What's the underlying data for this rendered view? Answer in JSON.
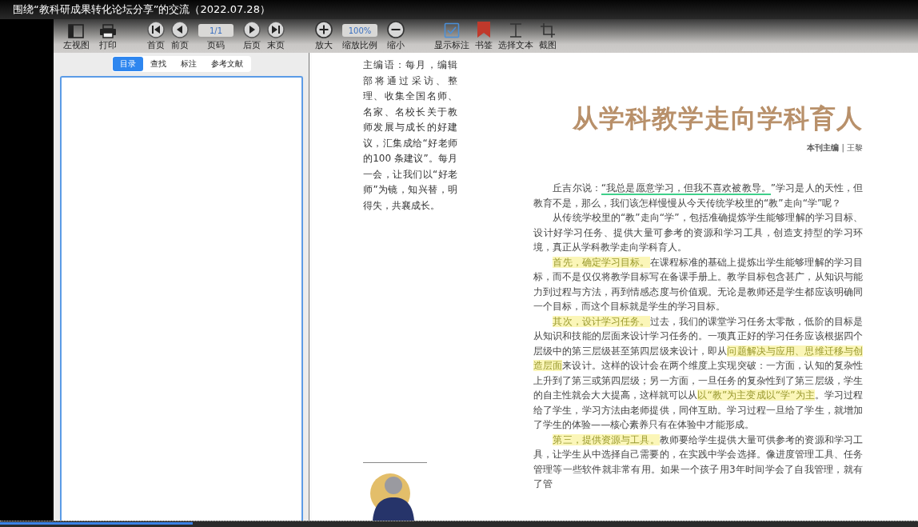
{
  "video_title": "围绕“教科研成果转化论坛分享”的交流（2022.07.28）",
  "toolbar": {
    "groups": [
      [
        {
          "kind": "button",
          "label": "左视图"
        },
        {
          "kind": "button",
          "label": "打印"
        }
      ],
      [
        {
          "kind": "button",
          "label": "首页"
        },
        {
          "kind": "button",
          "label": "前页"
        },
        {
          "kind": "field",
          "label": "页码",
          "value": "1/1"
        },
        {
          "kind": "button",
          "label": "后页"
        },
        {
          "kind": "button",
          "label": "末页"
        }
      ],
      [
        {
          "kind": "button",
          "label": "放大"
        },
        {
          "kind": "field",
          "label": "缩放比例",
          "value": "100%"
        },
        {
          "kind": "button",
          "label": "缩小"
        }
      ],
      [
        {
          "kind": "toggle",
          "label": "显示标注",
          "checked": true
        },
        {
          "kind": "button",
          "label": "书签"
        },
        {
          "kind": "button",
          "label": "选择文本"
        },
        {
          "kind": "button",
          "label": "截图"
        }
      ]
    ]
  },
  "sidebar": {
    "tabs": [
      {
        "label": "目录",
        "selected": true
      },
      {
        "label": "查找",
        "selected": false
      },
      {
        "label": "标注",
        "selected": false
      },
      {
        "label": "参考文献",
        "selected": false
      }
    ]
  },
  "page": {
    "intro": "主编语：每月，编辑部将通过采访、整理、收集全国名师、名家、名校长关于教师发展与成长的好建议，汇集成给“好老师的100 条建议”。每月一会，让我们以“好老师”为镜，知兴替，明得失，共襄成长。",
    "title": "从学科教学走向学科育人",
    "byline": "**本刊主编** | 王黎",
    "paragraphs": [
      {
        "segments": [
          {
            "kind": "plain",
            "text": "丘吉尔说："
          },
          {
            "kind": "underline",
            "text": "“我总是愿意学习，但我不喜欢被教导。"
          },
          {
            "kind": "plain",
            "text": "”学习是人的天性，但教育不是，那么，我们该怎样慢慢从今天传统学校里的“教”走向“学”呢？"
          }
        ]
      },
      {
        "segments": [
          {
            "kind": "plain",
            "text": "从传统学校里的“教”走向“学”，包括准确提炼学生能够理解的学习目标、设计好学习任务、提供大量可参考的资源和学习工具，创造支持型的学习环境，真正从学科教学走向学科育人。"
          }
        ]
      },
      {
        "segments": [
          {
            "kind": "highlight",
            "text": "首先，确定学习目标。"
          },
          {
            "kind": "plain",
            "text": "在课程标准的基础上提炼出学生能够理解的学习目标，而不是仅仅将教学目标写在备课手册上。教学目标包含甚广，从知识与能力到过程与方法，再到情感态度与价值观。无论是教师还是学生都应该明确同一个目标，而这个目标就是学生的学习目标。"
          }
        ]
      },
      {
        "segments": [
          {
            "kind": "highlight",
            "text": "其次，设计学习任务。"
          },
          {
            "kind": "plain",
            "text": "过去，我们的课堂学习任务太零散，低阶的目标是从知识和技能的层面来设计学习任务的。一项真正好的学习任务应该根据四个层级中的第三层级甚至第四层级来设计，即从"
          },
          {
            "kind": "highlight",
            "text": "问题解决与应用、思维迁移与创造层面"
          },
          {
            "kind": "plain",
            "text": "来设计。这样的设计会在两个维度上实现突破：一方面，认知的复杂性上升到了第三或第四层级；另一方面，一旦任务的复杂性到了第三层级，学生的自主性就会大大提高，这样就可以从"
          },
          {
            "kind": "highlight",
            "text": "以“教”为主变成以“学”为主"
          },
          {
            "kind": "plain",
            "text": "。学习过程给了学生，学习方法由老师提供，同伴互助。学习过程一旦给了学生，就增加了学生的体验——核心素养只有在体验中才能形成。"
          }
        ]
      },
      {
        "segments": [
          {
            "kind": "highlight",
            "text": "第三，提供资源与工具。"
          },
          {
            "kind": "plain",
            "text": "教师要给学生提供大量可供参考的资源和学习工具，让学生从中选择自己需要的，在实践中学会选择。像进度管理工具、任务管理等一些软件就非常有用。如果一个孩子用3年时间学会了自我管理，就有了管"
          }
        ]
      }
    ]
  },
  "video_progress": {
    "level": 0.21
  }
}
